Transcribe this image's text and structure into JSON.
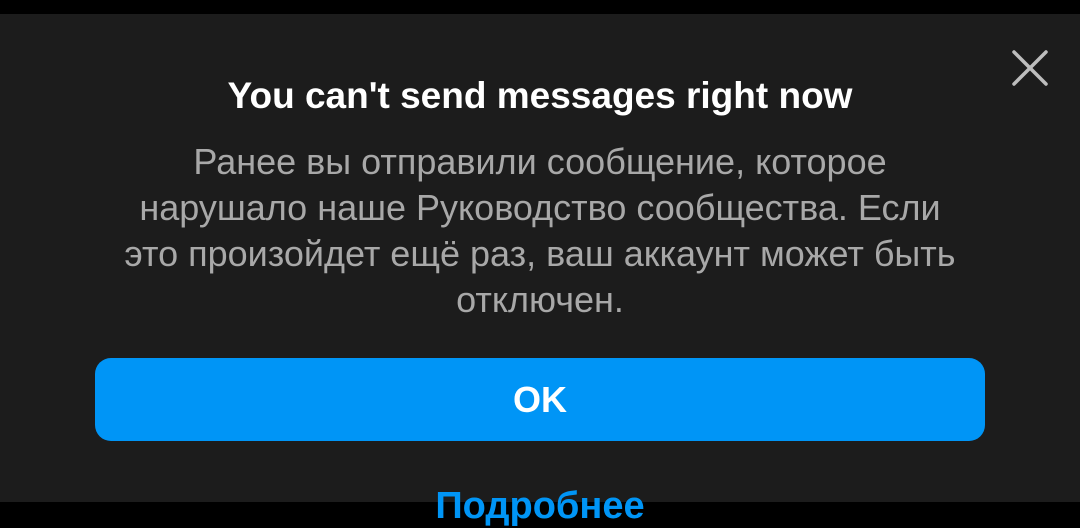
{
  "dialog": {
    "title": "You can't send messages right now",
    "message": "Ранее вы отправили сообщение, которое нарушало наше Руководство сообщества. Если это произойдет ещё раз, ваш аккаунт может быть отключен.",
    "ok_label": "OK",
    "more_label": "Подробнее",
    "close_icon": "close-icon"
  },
  "colors": {
    "background": "#1c1c1c",
    "accent": "#0095f6",
    "title": "#ffffff",
    "body_text": "#a8a8a8"
  }
}
